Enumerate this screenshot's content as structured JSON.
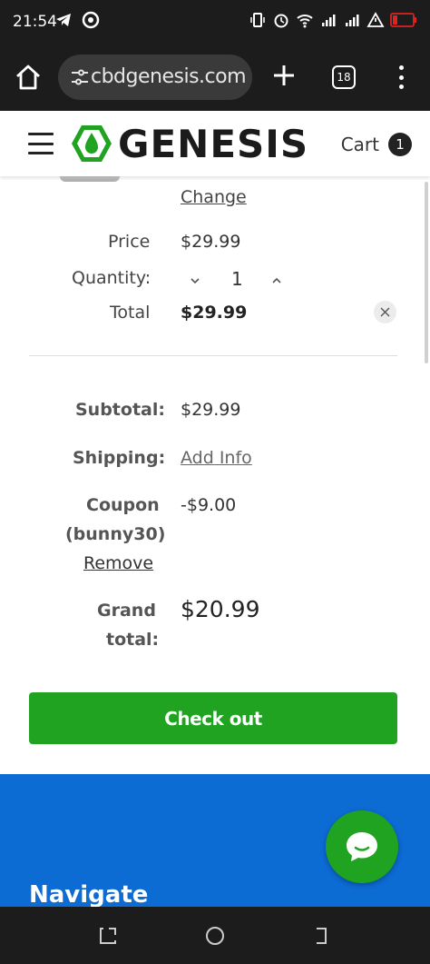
{
  "status_bar": {
    "time": "21:54",
    "left_icons": [
      "telegram-icon",
      "instagram-icon"
    ],
    "right_icons": [
      "vibrate-icon",
      "alarm-icon",
      "wifi-icon",
      "signal-icon",
      "signal-icon",
      "warning-icon",
      "battery-icon"
    ]
  },
  "browser": {
    "url": "cbdgenesis.com",
    "tab_count": "18"
  },
  "header": {
    "logo_text": "GENESIS",
    "cart_label": "Cart",
    "cart_count": "1"
  },
  "cart_item": {
    "change_label": "Change",
    "price_label": "Price",
    "price_value": "$29.99",
    "quantity_label": "Quantity:",
    "quantity_value": "1",
    "total_label": "Total",
    "total_value": "$29.99"
  },
  "summary": {
    "subtotal_label": "Subtotal:",
    "subtotal_value": "$29.99",
    "shipping_label": "Shipping:",
    "shipping_value": "Add Info",
    "coupon_label": "Coupon",
    "coupon_code": "(bunny30)",
    "coupon_value": "-$9.00",
    "coupon_remove": "Remove",
    "grand_label_1": "Grand",
    "grand_label_2": "total:",
    "grand_value": "$20.99"
  },
  "checkout_label": "Check out",
  "footer": {
    "navigate_label": "Navigate"
  },
  "colors": {
    "accent_green": "#1fa320",
    "footer_blue": "#0d6bd4"
  }
}
